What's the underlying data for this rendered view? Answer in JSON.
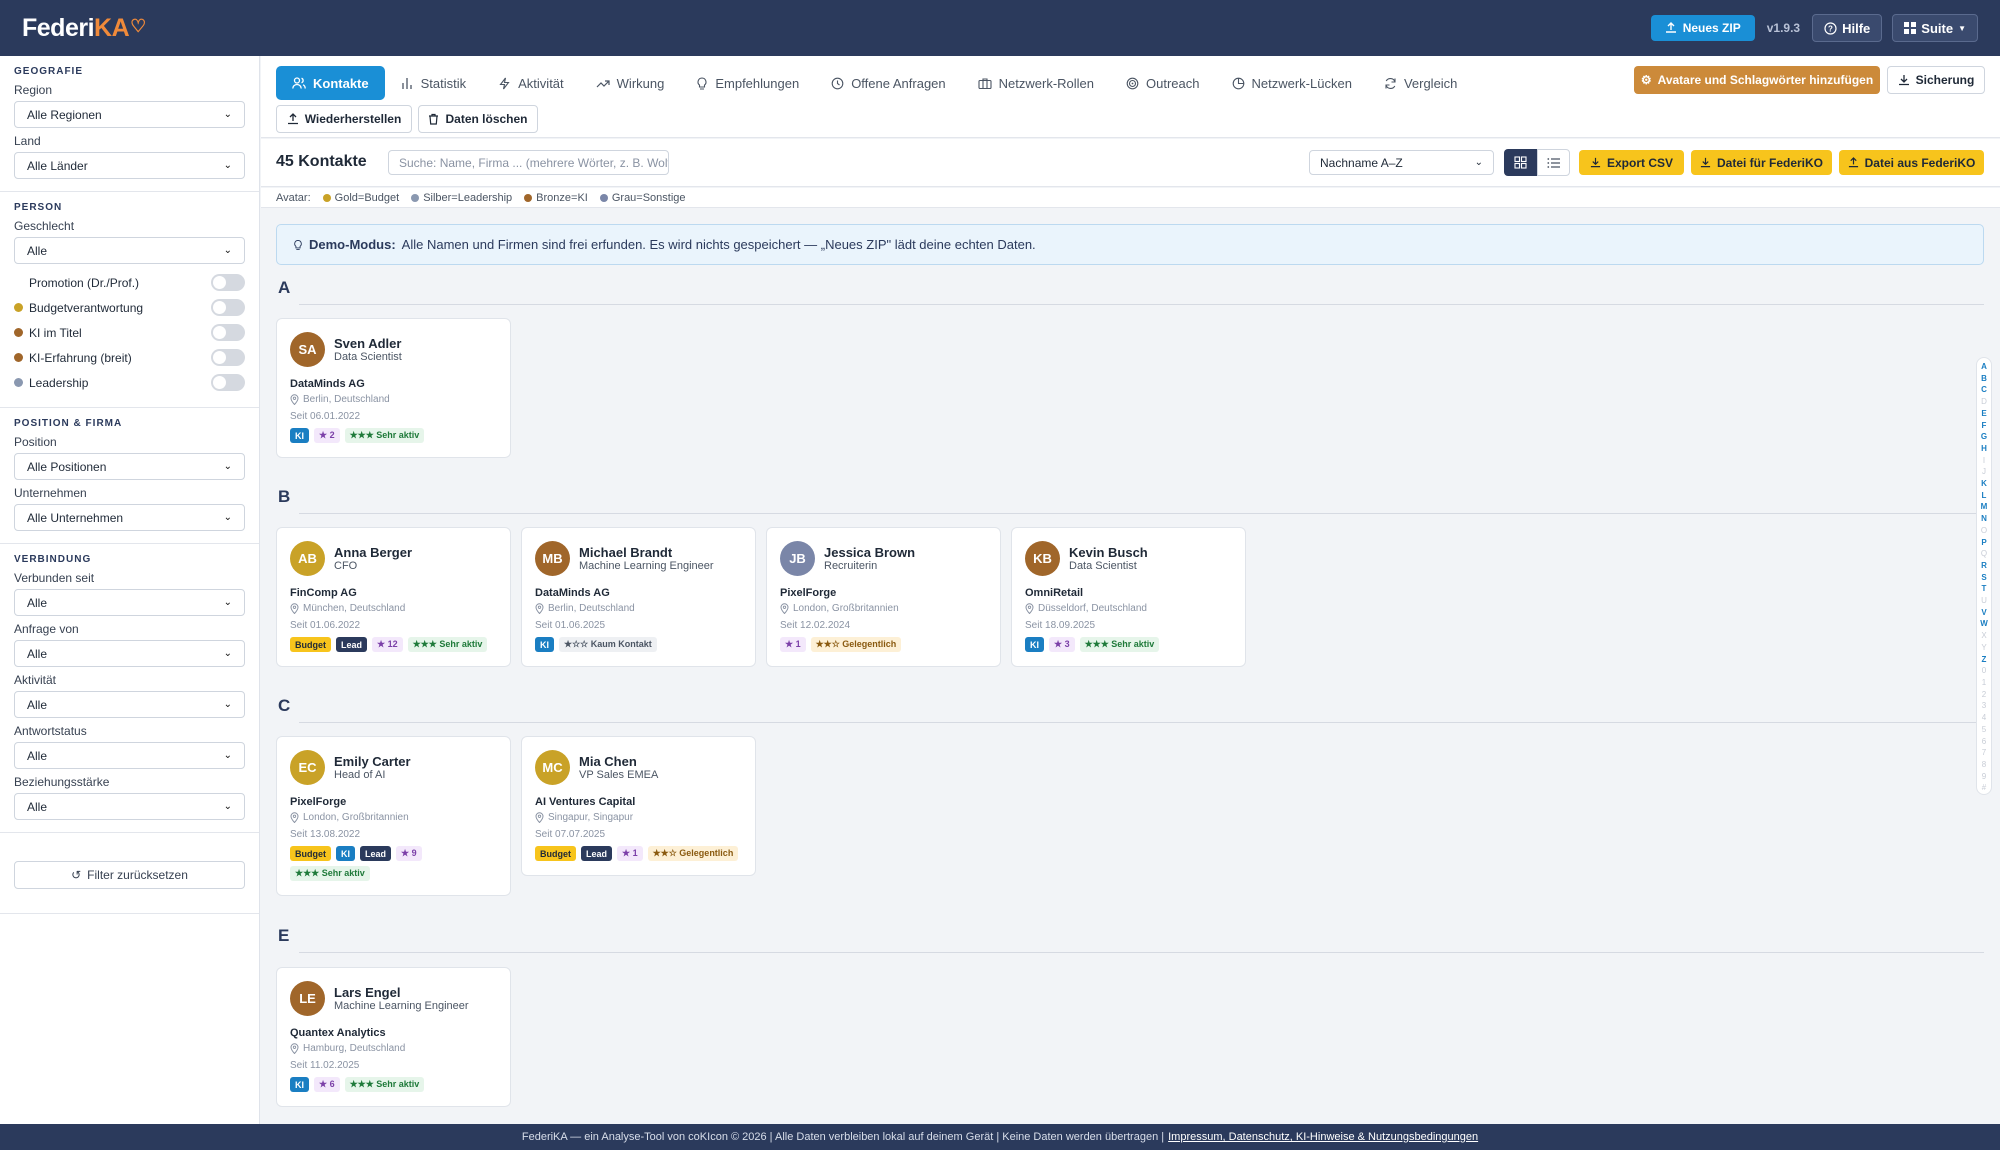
{
  "app": {
    "logo_part1": "Federi",
    "logo_part2": "KA",
    "version": "v1.9.3"
  },
  "topbar": {
    "new_zip": "Neues ZIP",
    "help": "Hilfe",
    "suite": "Suite"
  },
  "sidebar": {
    "geo_head": "GEOGRAFIE",
    "region_label": "Region",
    "region_value": "Alle Regionen",
    "country_label": "Land",
    "country_value": "Alle Länder",
    "person_head": "PERSON",
    "gender_label": "Geschlecht",
    "gender_value": "Alle",
    "toggles": [
      {
        "label": "Promotion (Dr./Prof.)",
        "dot": ""
      },
      {
        "label": "Budgetverantwortung",
        "dot": "#c9a227"
      },
      {
        "label": "KI im Titel",
        "dot": "#a0662a"
      },
      {
        "label": "KI-Erfahrung (breit)",
        "dot": "#a0662a"
      },
      {
        "label": "Leadership",
        "dot": "#8a98b0"
      }
    ],
    "pos_head": "POSITION & FIRMA",
    "position_label": "Position",
    "position_value": "Alle Positionen",
    "company_label": "Unternehmen",
    "company_value": "Alle Unternehmen",
    "conn_head": "VERBINDUNG",
    "connected_label": "Verbunden seit",
    "connected_value": "Alle",
    "request_label": "Anfrage von",
    "request_value": "Alle",
    "activity_label": "Aktivität",
    "activity_value": "Alle",
    "answer_label": "Antwortstatus",
    "answer_value": "Alle",
    "strength_label": "Beziehungsstärke",
    "strength_value": "Alle",
    "reset": "Filter zurücksetzen"
  },
  "tabs": [
    "Kontakte",
    "Statistik",
    "Aktivität",
    "Wirkung",
    "Empfehlungen",
    "Offene Anfragen",
    "Netzwerk-Rollen",
    "Outreach",
    "Netzwerk-Lücken",
    "Vergleich"
  ],
  "actions": {
    "avatars": "Avatare und Schlagwörter hinzufügen",
    "backup": "Sicherung",
    "restore": "Wiederherstellen",
    "delete": "Daten löschen"
  },
  "toolbar": {
    "count": "45 Kontakte",
    "search_placeholder": "Suche: Name, Firma ... (mehrere Wörter, z. B. Wolf",
    "sort": "Nachname A–Z",
    "export": "Export CSV",
    "file_for": "Datei für FederiKO",
    "file_from": "Datei aus FederiKO"
  },
  "legend": {
    "label": "Avatar:",
    "gold": "Gold=Budget",
    "silver": "Silber=Leadership",
    "bronze": "Bronze=KI",
    "grey": "Grau=Sonstige"
  },
  "demo": {
    "strong": "Demo-Modus:",
    "text": "Alle Namen und Firmen sind frei erfunden. Es wird nichts gespeichert — „Neues ZIP\" lädt deine echten Daten."
  },
  "groups": [
    {
      "letter": "A",
      "contacts": [
        {
          "initials": "SA",
          "color": "#a0662a",
          "name": "Sven Adler",
          "title": "Data Scientist",
          "company": "DataMinds AG",
          "location": "Berlin, Deutschland",
          "since": "Seit 06.01.2022",
          "badges": [
            {
              "t": "ki",
              "l": "KI"
            },
            {
              "t": "star",
              "l": "★ 2"
            },
            {
              "t": "act-high",
              "l": "★★★ Sehr aktiv"
            }
          ]
        }
      ]
    },
    {
      "letter": "B",
      "contacts": [
        {
          "initials": "AB",
          "color": "#c9a227",
          "name": "Anna Berger",
          "title": "CFO",
          "company": "FinComp AG",
          "location": "München, Deutschland",
          "since": "Seit 01.06.2022",
          "badges": [
            {
              "t": "budget",
              "l": "Budget"
            },
            {
              "t": "lead",
              "l": "Lead"
            },
            {
              "t": "star",
              "l": "★ 12"
            },
            {
              "t": "act-high",
              "l": "★★★ Sehr aktiv"
            }
          ]
        },
        {
          "initials": "MB",
          "color": "#a0662a",
          "name": "Michael Brandt",
          "title": "Machine Learning Engineer",
          "company": "DataMinds AG",
          "location": "Berlin, Deutschland",
          "since": "Seit 01.06.2025",
          "badges": [
            {
              "t": "ki",
              "l": "KI"
            },
            {
              "t": "act-low",
              "l": "★☆☆ Kaum Kontakt"
            }
          ]
        },
        {
          "initials": "JB",
          "color": "#7a86a8",
          "name": "Jessica Brown",
          "title": "Recruiterin",
          "company": "PixelForge",
          "location": "London, Großbritannien",
          "since": "Seit 12.02.2024",
          "badges": [
            {
              "t": "star",
              "l": "★ 1"
            },
            {
              "t": "act-mid",
              "l": "★★☆ Gelegentlich"
            }
          ]
        },
        {
          "initials": "KB",
          "color": "#a0662a",
          "name": "Kevin Busch",
          "title": "Data Scientist",
          "company": "OmniRetail",
          "location": "Düsseldorf, Deutschland",
          "since": "Seit 18.09.2025",
          "badges": [
            {
              "t": "ki",
              "l": "KI"
            },
            {
              "t": "star",
              "l": "★ 3"
            },
            {
              "t": "act-high",
              "l": "★★★ Sehr aktiv"
            }
          ]
        }
      ]
    },
    {
      "letter": "C",
      "contacts": [
        {
          "initials": "EC",
          "color": "#c9a227",
          "name": "Emily Carter",
          "title": "Head of AI",
          "company": "PixelForge",
          "location": "London, Großbritannien",
          "since": "Seit 13.08.2022",
          "badges": [
            {
              "t": "budget",
              "l": "Budget"
            },
            {
              "t": "ki",
              "l": "KI"
            },
            {
              "t": "lead",
              "l": "Lead"
            },
            {
              "t": "star",
              "l": "★ 9"
            },
            {
              "t": "act-high",
              "l": "★★★ Sehr aktiv"
            }
          ]
        },
        {
          "initials": "MC",
          "color": "#c9a227",
          "name": "Mia Chen",
          "title": "VP Sales EMEA",
          "company": "AI Ventures Capital",
          "location": "Singapur, Singapur",
          "since": "Seit 07.07.2025",
          "badges": [
            {
              "t": "budget",
              "l": "Budget"
            },
            {
              "t": "lead",
              "l": "Lead"
            },
            {
              "t": "star",
              "l": "★ 1"
            },
            {
              "t": "act-mid",
              "l": "★★☆ Gelegentlich"
            }
          ]
        }
      ]
    },
    {
      "letter": "E",
      "contacts": [
        {
          "initials": "LE",
          "color": "#a0662a",
          "name": "Lars Engel",
          "title": "Machine Learning Engineer",
          "company": "Quantex Analytics",
          "location": "Hamburg, Deutschland",
          "since": "Seit 11.02.2025",
          "badges": [
            {
              "t": "ki",
              "l": "KI"
            },
            {
              "t": "star",
              "l": "★ 6"
            },
            {
              "t": "act-high",
              "l": "★★★ Sehr aktiv"
            }
          ]
        }
      ]
    }
  ],
  "az_index": [
    {
      "c": "A",
      "on": true
    },
    {
      "c": "B",
      "on": true
    },
    {
      "c": "C",
      "on": true
    },
    {
      "c": "D",
      "on": false
    },
    {
      "c": "E",
      "on": true
    },
    {
      "c": "F",
      "on": true
    },
    {
      "c": "G",
      "on": true
    },
    {
      "c": "H",
      "on": true
    },
    {
      "c": "I",
      "on": false
    },
    {
      "c": "J",
      "on": false
    },
    {
      "c": "K",
      "on": true
    },
    {
      "c": "L",
      "on": true
    },
    {
      "c": "M",
      "on": true
    },
    {
      "c": "N",
      "on": true
    },
    {
      "c": "O",
      "on": false
    },
    {
      "c": "P",
      "on": true
    },
    {
      "c": "Q",
      "on": false
    },
    {
      "c": "R",
      "on": true
    },
    {
      "c": "S",
      "on": true
    },
    {
      "c": "T",
      "on": true
    },
    {
      "c": "U",
      "on": false
    },
    {
      "c": "V",
      "on": true
    },
    {
      "c": "W",
      "on": true
    },
    {
      "c": "X",
      "on": false
    },
    {
      "c": "Y",
      "on": false
    },
    {
      "c": "Z",
      "on": true
    },
    {
      "c": "0",
      "on": false
    },
    {
      "c": "1",
      "on": false
    },
    {
      "c": "2",
      "on": false
    },
    {
      "c": "3",
      "on": false
    },
    {
      "c": "4",
      "on": false
    },
    {
      "c": "5",
      "on": false
    },
    {
      "c": "6",
      "on": false
    },
    {
      "c": "7",
      "on": false
    },
    {
      "c": "8",
      "on": false
    },
    {
      "c": "9",
      "on": false
    },
    {
      "c": "#",
      "on": false
    }
  ],
  "footer": {
    "text": "FederiKA — ein Analyse-Tool von coKIcon © 2026 | Alle Daten verbleiben lokal auf deinem Gerät | Keine Daten werden übertragen |",
    "link": "Impressum, Datenschutz, KI-Hinweise & Nutzungsbedingungen"
  },
  "colors": {
    "navy": "#2b3a5c",
    "accent": "#1a8fd6",
    "yellow": "#f7c41c",
    "orange": "#cc8a3a"
  }
}
